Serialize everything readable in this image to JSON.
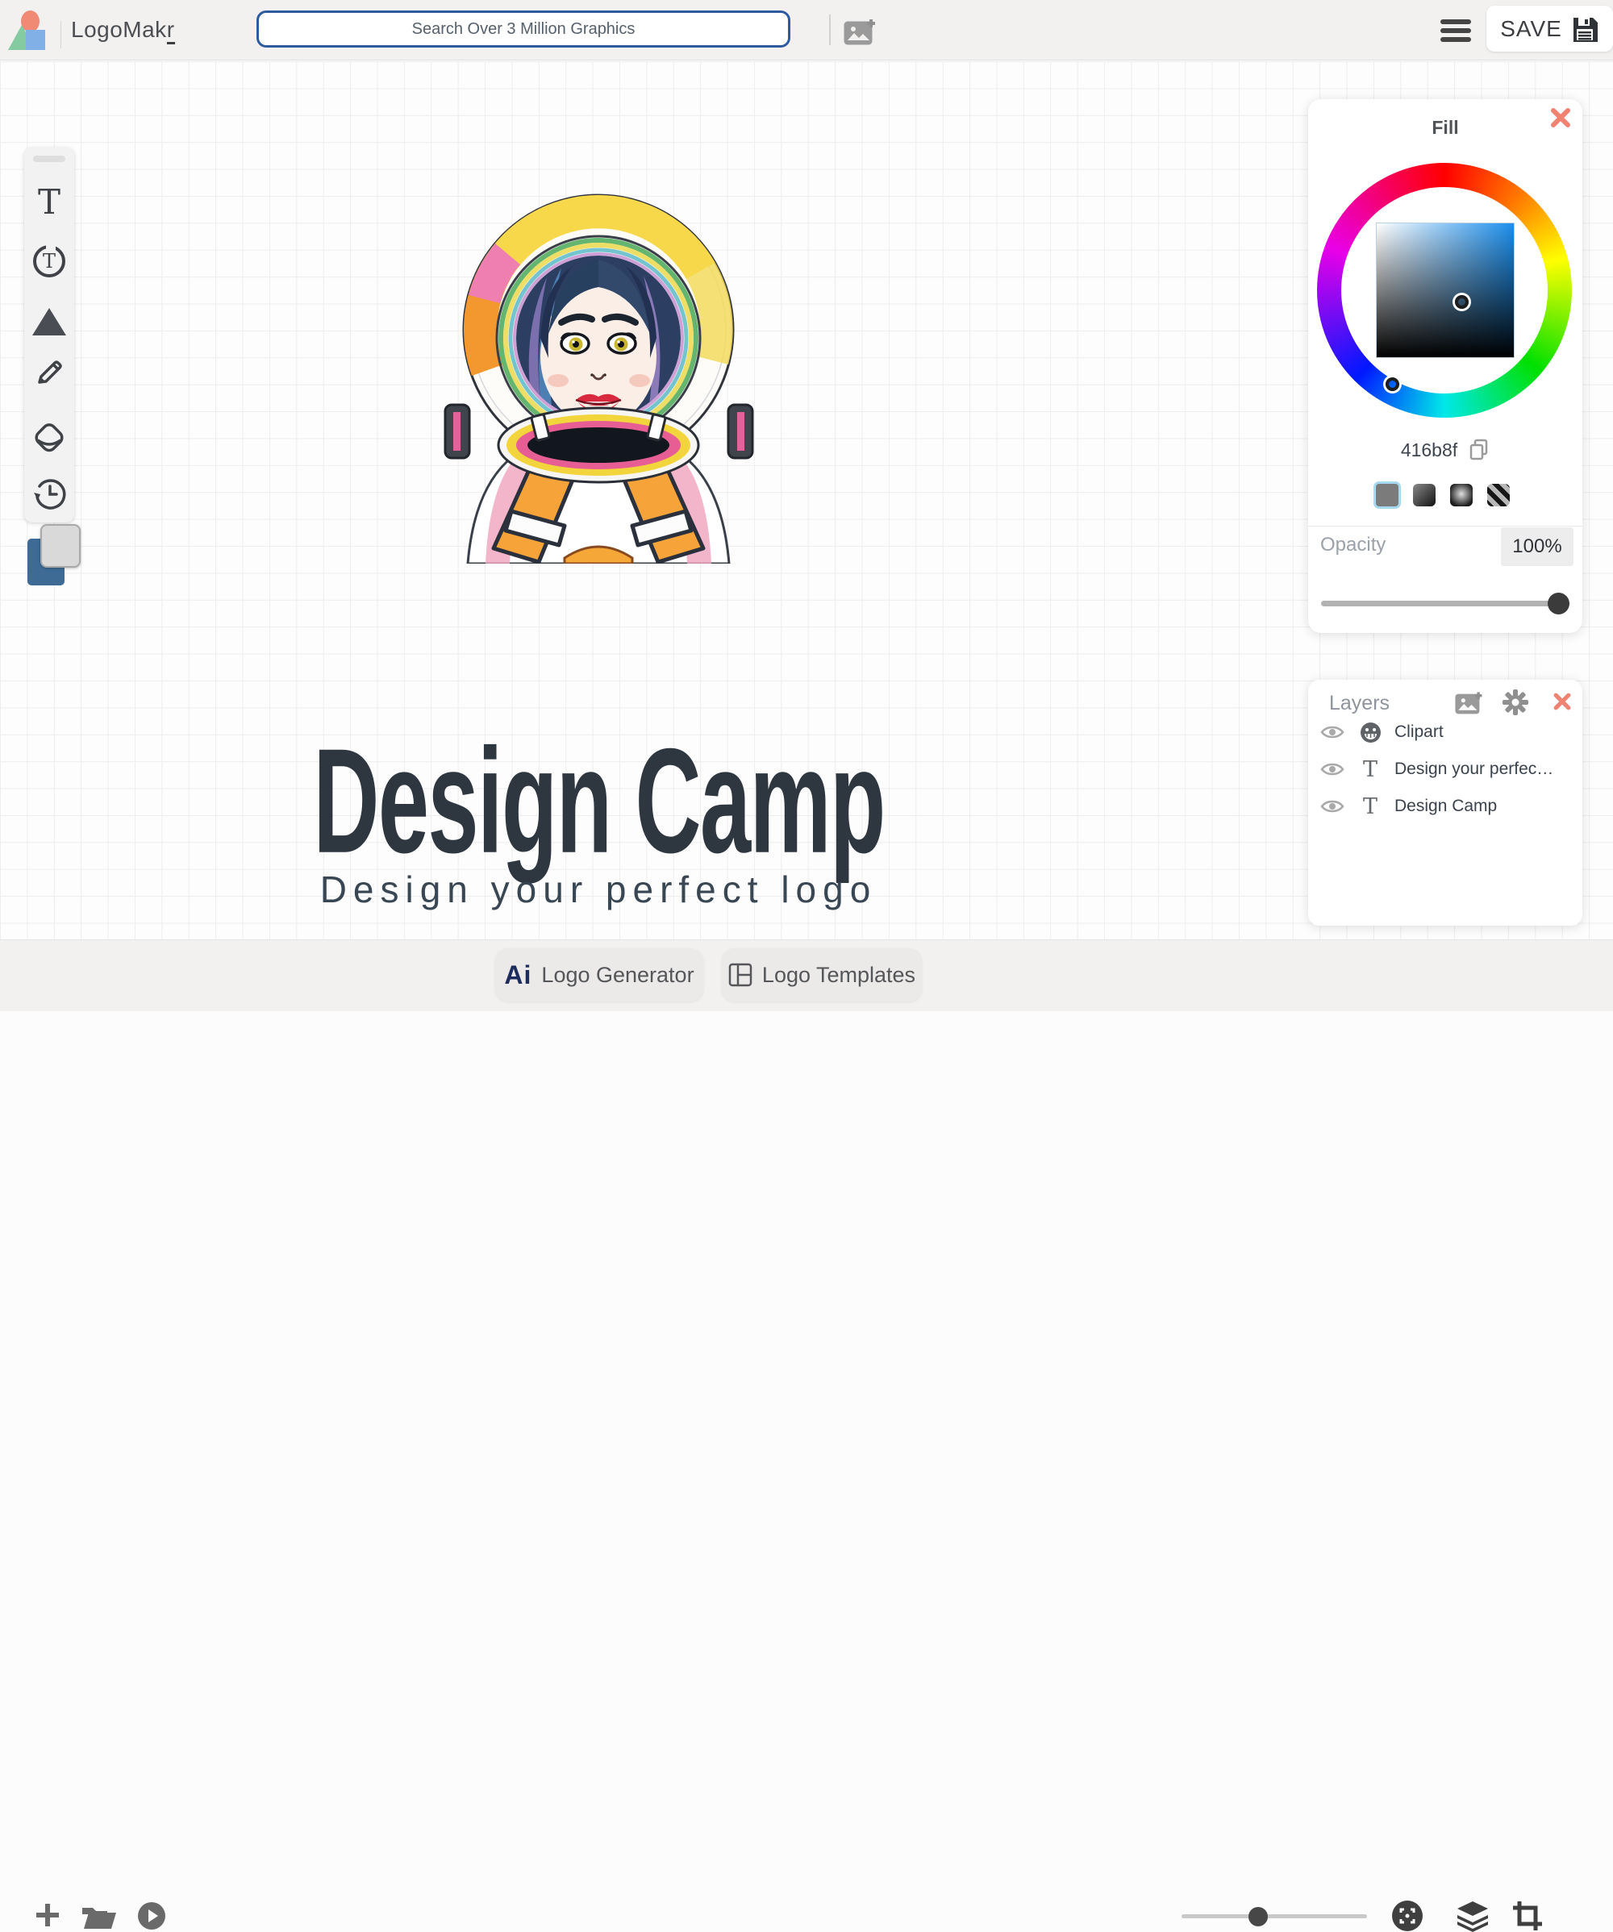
{
  "header": {
    "brand_prefix": "LogoMak",
    "brand_suffix": "r",
    "search_placeholder": "Search Over 3 Million Graphics",
    "save_label": "SAVE"
  },
  "icons": {
    "text_tool_glyph": "T",
    "text_circle_glyph": "T",
    "layer_text_glyph": "T"
  },
  "fill_panel": {
    "title": "Fill",
    "hex": "416b8f",
    "opacity_label": "Opacity",
    "opacity_value": "100%"
  },
  "layers_panel": {
    "title": "Layers",
    "layers": [
      {
        "label": "Clipart"
      },
      {
        "label": "Design your perfec…"
      },
      {
        "label": "Design Camp"
      }
    ]
  },
  "canvas": {
    "logo_title": "Design Camp",
    "logo_subtitle": "Design your perfect logo"
  },
  "footer": {
    "ai_label": "Ai",
    "generator_label": "Logo Generator",
    "templates_label": "Logo Templates"
  },
  "colors": {
    "accent_blue": "#2d5b9e",
    "selected_fill": "#416b8f",
    "close_salmon": "#f08272"
  }
}
